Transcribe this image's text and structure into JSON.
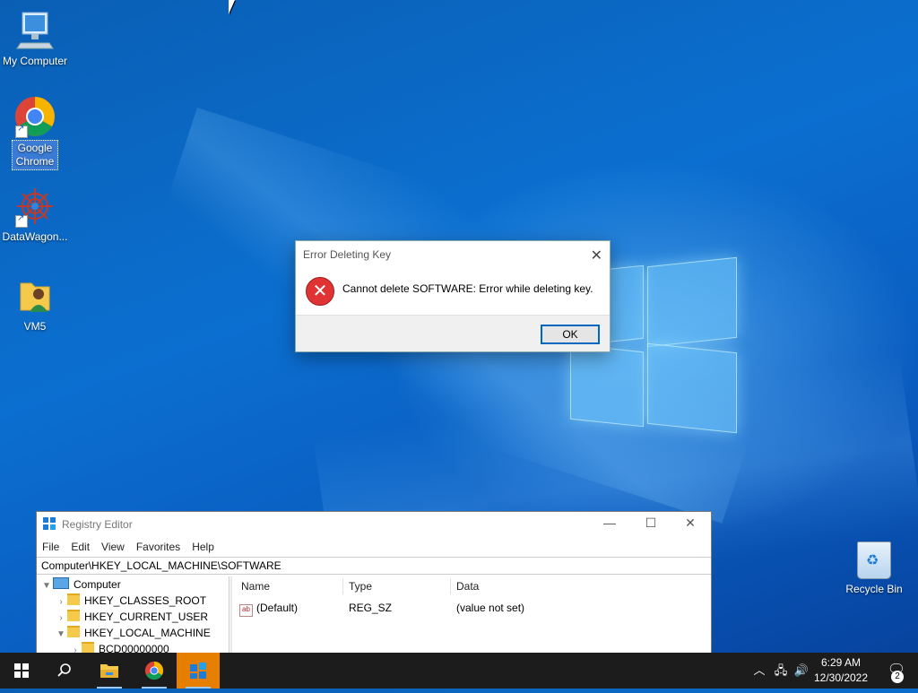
{
  "desktop": {
    "icons": [
      {
        "label": "My Computer",
        "icon": "monitor-icon"
      },
      {
        "label": "Google\nChrome",
        "icon": "chrome-icon"
      },
      {
        "label": "DataWagon...",
        "icon": "datawagon-icon"
      },
      {
        "label": "VM5",
        "icon": "user-folder-icon"
      }
    ],
    "recycle_bin": {
      "label": "Recycle Bin",
      "icon": "recycle-bin-icon"
    }
  },
  "dialog": {
    "title": "Error Deleting Key",
    "message": "Cannot delete SOFTWARE:  Error while deleting key.",
    "ok_label": "OK",
    "icon": "error-icon"
  },
  "registry_editor": {
    "title": "Registry Editor",
    "menu": [
      "File",
      "Edit",
      "View",
      "Favorites",
      "Help"
    ],
    "address": "Computer\\HKEY_LOCAL_MACHINE\\SOFTWARE",
    "tree": [
      {
        "label": "Computer",
        "expanded": true
      },
      {
        "label": "HKEY_CLASSES_ROOT",
        "expanded": false
      },
      {
        "label": "HKEY_CURRENT_USER",
        "expanded": false
      },
      {
        "label": "HKEY_LOCAL_MACHINE",
        "expanded": true
      },
      {
        "label": "BCD00000000",
        "expanded": false
      }
    ],
    "columns": [
      "Name",
      "Type",
      "Data"
    ],
    "rows": [
      {
        "name": "(Default)",
        "type": "REG_SZ",
        "data": "(value not set)"
      }
    ],
    "window_buttons": {
      "minimize": "—",
      "maximize": "☐",
      "close": "✕"
    }
  },
  "taskbar": {
    "apps": [
      "start-icon",
      "search-icon",
      "file-explorer-icon",
      "chrome-icon",
      "registry-editor-icon"
    ],
    "clock_time": "6:29 AM",
    "clock_date": "12/30/2022",
    "notification_count": "2",
    "colors": {
      "taskbar": "#1c1c1c",
      "active_app": "#e67e00",
      "accent": "#0067c0"
    }
  }
}
